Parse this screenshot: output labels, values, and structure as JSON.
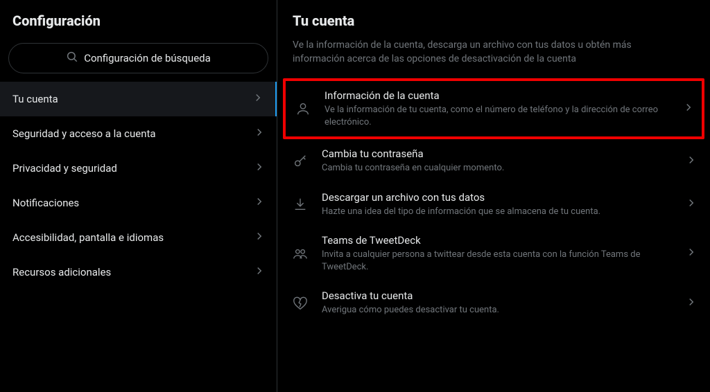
{
  "sidebar": {
    "title": "Configuración",
    "search_placeholder": "Configuración de búsqueda",
    "items": [
      {
        "label": "Tu cuenta",
        "active": true
      },
      {
        "label": "Seguridad y acceso a la cuenta",
        "active": false
      },
      {
        "label": "Privacidad y seguridad",
        "active": false
      },
      {
        "label": "Notificaciones",
        "active": false
      },
      {
        "label": "Accesibilidad, pantalla e idiomas",
        "active": false
      },
      {
        "label": "Recursos adicionales",
        "active": false
      }
    ]
  },
  "main": {
    "title": "Tu cuenta",
    "description": "Ve la información de la cuenta, descarga un archivo con tus datos u obtén más información acerca de las opciones de desactivación de la cuenta",
    "options": [
      {
        "title": "Información de la cuenta",
        "subtitle": "Ve la información de tu cuenta, como el número de teléfono y la dirección de correo electrónico.",
        "icon": "user",
        "highlighted": true
      },
      {
        "title": "Cambia tu contraseña",
        "subtitle": "Cambia tu contraseña en cualquier momento.",
        "icon": "key",
        "highlighted": false
      },
      {
        "title": "Descargar un archivo con tus datos",
        "subtitle": "Hazte una idea del tipo de información que se almacena de tu cuenta.",
        "icon": "download",
        "highlighted": false
      },
      {
        "title": "Teams de TweetDeck",
        "subtitle": "Invita a cualquier persona a twittear desde esta cuenta con la función Teams de TweetDeck.",
        "icon": "people",
        "highlighted": false
      },
      {
        "title": "Desactiva tu cuenta",
        "subtitle": "Averigua cómo puedes desactivar tu cuenta.",
        "icon": "heartbreak",
        "highlighted": false
      }
    ]
  }
}
